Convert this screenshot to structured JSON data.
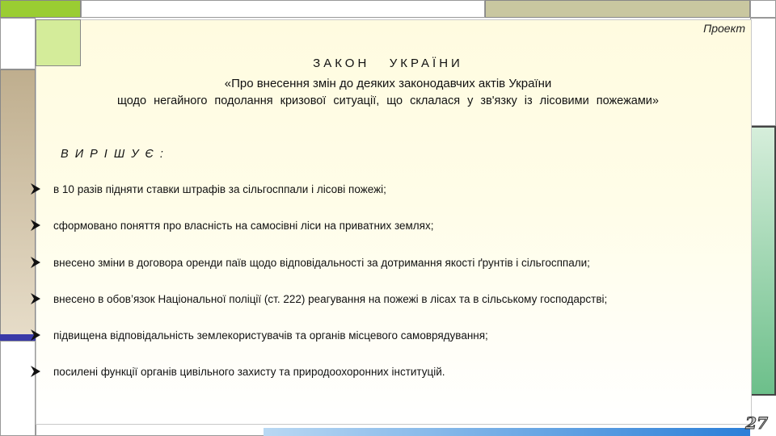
{
  "stamp": "Проект",
  "title": {
    "keyword": "ЗАКОН   УКРАЇНИ",
    "line2": "«Про внесення змін до деяких законодавчих  актів  України",
    "line3": "щодо негайного подолання кризової ситуації, що склалася у зв'язку із лісовими пожежами»"
  },
  "decides": "В И Р І Ш У Є :",
  "bullets": [
    "в 10 разів підняти ставки штрафів за сільгосппали і лісові пожежі;",
    "сформовано поняття про власність на самосівні ліси на приватних землях;",
    "внесено зміни в договора оренди паїв щодо відповідальності за дотримання якості ґрунтів і сільгосппали;",
    "внесено в обов’язок Національної поліції (ст. 222) реагування на пожежі в лісах та в сільському господарстві;",
    "підвищена відповідальність землекористувачів та органів місцевого самоврядування;",
    "посилені функції органів цивільного захисту та природоохоронних інституцій."
  ],
  "page_number": "27",
  "colors": {
    "green_accent": "#9acd32",
    "olive_block": "#c9c7a0",
    "blue_stripe": "#3a3aa8",
    "teal_gradient": "#6cbf8a"
  }
}
